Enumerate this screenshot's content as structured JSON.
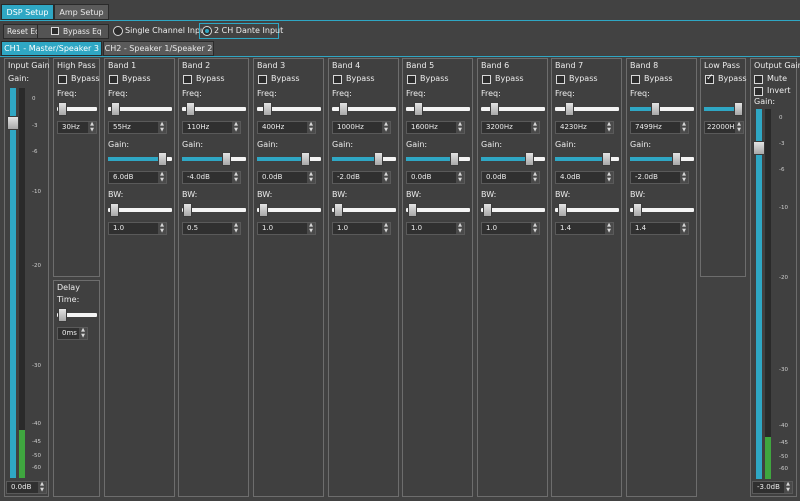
{
  "tabs": {
    "dsp_setup": "DSP Setup",
    "amp_setup": "Amp Setup"
  },
  "toolbar": {
    "reset_eq": "Reset Eq",
    "bypass_eq": "Bypass Eq",
    "single_channel": "Single Channel Input",
    "dante_input": "2 CH Dante Input",
    "selected_input": "2 CH Dante Input"
  },
  "channel_tabs": {
    "ch1": "CH1 - Master/Speaker 3",
    "ch2": "CH2 - Speaker 1/Speaker 2"
  },
  "input_gain": {
    "title": "Input Gain",
    "gain_label": "Gain:",
    "value": "0.0dB",
    "scale": [
      "0",
      "-3",
      "-6",
      "-10",
      "-20",
      "-30",
      "-40",
      "-45",
      "-50",
      "-60"
    ]
  },
  "high_pass": {
    "title": "High Pass",
    "bypass_label": "Bypass",
    "freq_label": "Freq:",
    "freq": "30Hz",
    "bypass": false
  },
  "delay": {
    "title": "Delay",
    "time_label": "Time:",
    "value": "0ms"
  },
  "bands_labels": {
    "bypass": "Bypass",
    "freq": "Freq:",
    "gain": "Gain:",
    "bw": "BW:"
  },
  "bands": [
    {
      "title": "Band 1",
      "freq": "55Hz",
      "gain": "6.0dB",
      "bw": "1.0",
      "freq_pos": 0.05,
      "gain_pos": 0.9,
      "bw_pos": 0.04
    },
    {
      "title": "Band 2",
      "freq": "110Hz",
      "gain": "-4.0dB",
      "bw": "0.5",
      "freq_pos": 0.07,
      "gain_pos": 0.72,
      "bw_pos": 0.02
    },
    {
      "title": "Band 3",
      "freq": "400Hz",
      "gain": "0.0dB",
      "bw": "1.0",
      "freq_pos": 0.1,
      "gain_pos": 0.8,
      "bw_pos": 0.04
    },
    {
      "title": "Band 4",
      "freq": "1000Hz",
      "gain": "-2.0dB",
      "bw": "1.0",
      "freq_pos": 0.12,
      "gain_pos": 0.76,
      "bw_pos": 0.04
    },
    {
      "title": "Band 5",
      "freq": "1600Hz",
      "gain": "0.0dB",
      "bw": "1.0",
      "freq_pos": 0.14,
      "gain_pos": 0.8,
      "bw_pos": 0.04
    },
    {
      "title": "Band 6",
      "freq": "3200Hz",
      "gain": "0.0dB",
      "bw": "1.0",
      "freq_pos": 0.16,
      "gain_pos": 0.8,
      "bw_pos": 0.04
    },
    {
      "title": "Band 7",
      "freq": "4230Hz",
      "gain": "4.0dB",
      "bw": "1.4",
      "freq_pos": 0.18,
      "gain_pos": 0.86,
      "bw_pos": 0.06
    },
    {
      "title": "Band 8",
      "freq": "7499Hz",
      "gain": "-2.0dB",
      "bw": "1.4",
      "freq_pos": 0.38,
      "gain_pos": 0.76,
      "bw_pos": 0.06
    }
  ],
  "low_pass": {
    "title": "Low Pass",
    "bypass_label": "Bypass",
    "freq": "22000Hz",
    "bypass": true
  },
  "output_gain": {
    "title": "Output Gain",
    "mute_label": "Mute",
    "invert_label": "Invert",
    "gain_label": "Gain:",
    "value": "-3.0dB",
    "scale": [
      "0",
      "-3",
      "-6",
      "-10",
      "-20",
      "-30",
      "-40",
      "-45",
      "-50",
      "-60"
    ]
  },
  "colors": {
    "accent": "#2fa7c4",
    "background": "#424242",
    "meter": "#3fa63f"
  }
}
